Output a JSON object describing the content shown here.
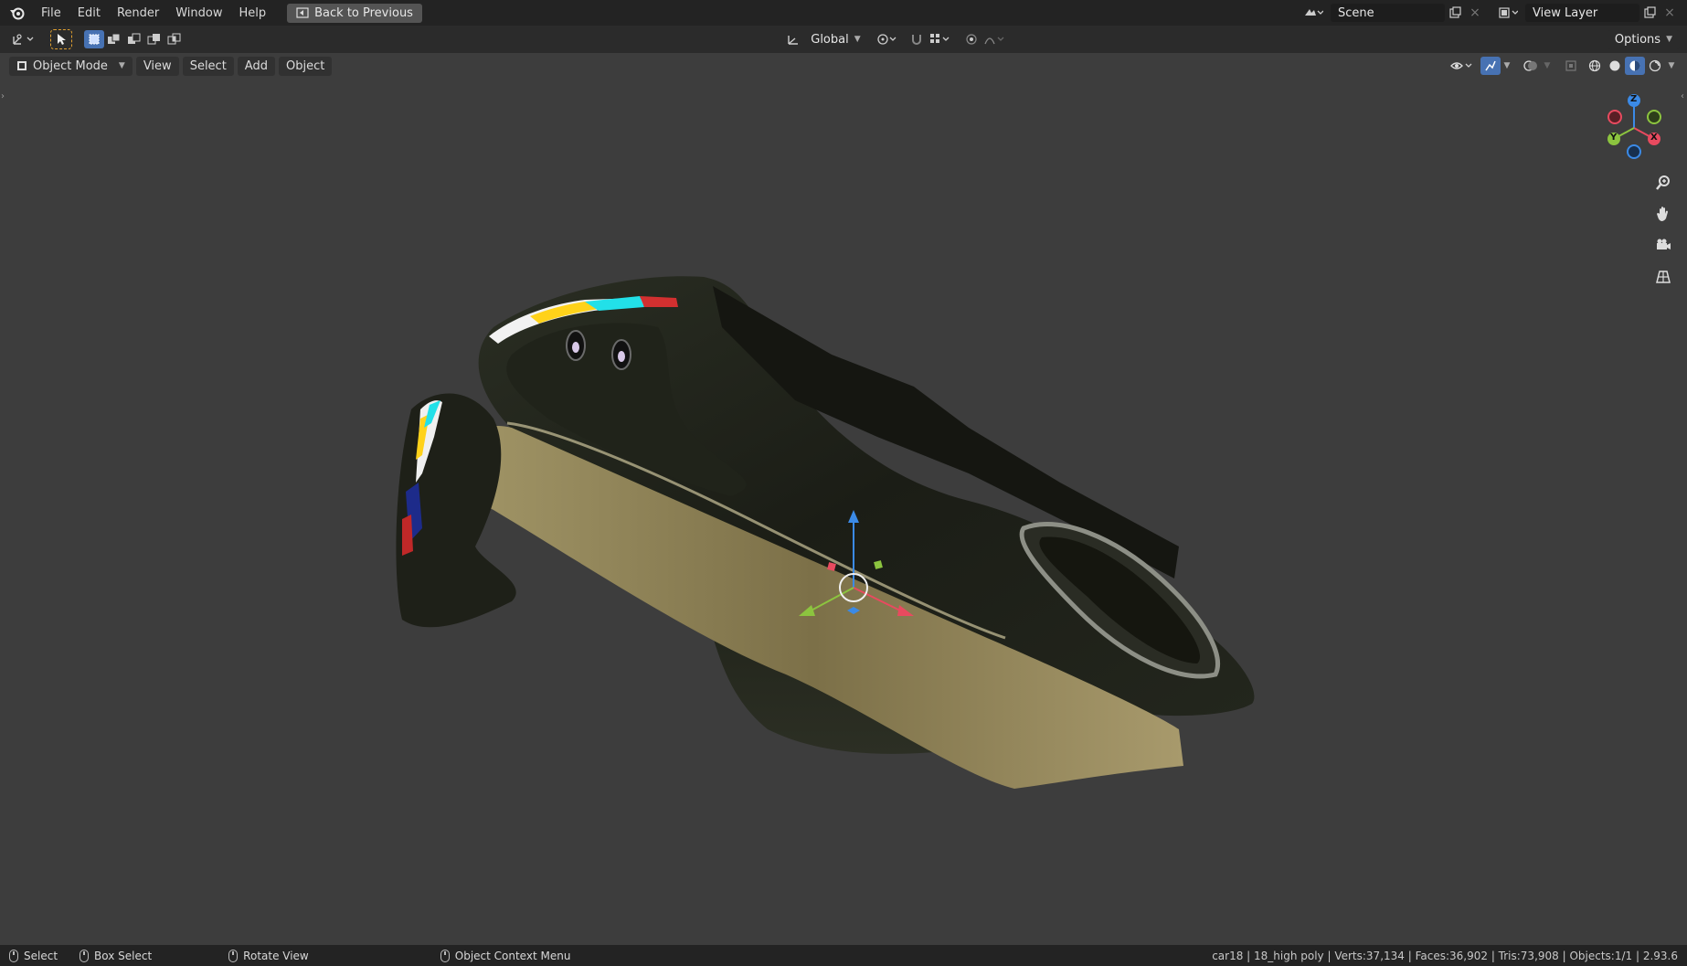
{
  "topbar": {
    "menu": [
      "File",
      "Edit",
      "Render",
      "Window",
      "Help"
    ],
    "back_button": "Back to Previous",
    "scene": "Scene",
    "view_layer": "View Layer"
  },
  "toolheader": {
    "transform_orientation": "Global",
    "options": "Options"
  },
  "viewheader": {
    "mode": "Object Mode",
    "menus": [
      "View",
      "Select",
      "Add",
      "Object"
    ]
  },
  "gizmo": {
    "z_label": "Z",
    "y_label": "Y",
    "x_label": "X"
  },
  "statusbar": {
    "select": "Select",
    "box_select": "Box Select",
    "rotate_view": "Rotate View",
    "context_menu": "Object Context Menu",
    "stats": "car18 | 18_high poly | Verts:37,134 | Faces:36,902 | Tris:73,908 | Objects:1/1 | 2.93.6"
  },
  "colors": {
    "accent": "#4772b3",
    "axis_x": "#e84a5f",
    "axis_y": "#8cc43f",
    "axis_z": "#3b8ae6"
  }
}
